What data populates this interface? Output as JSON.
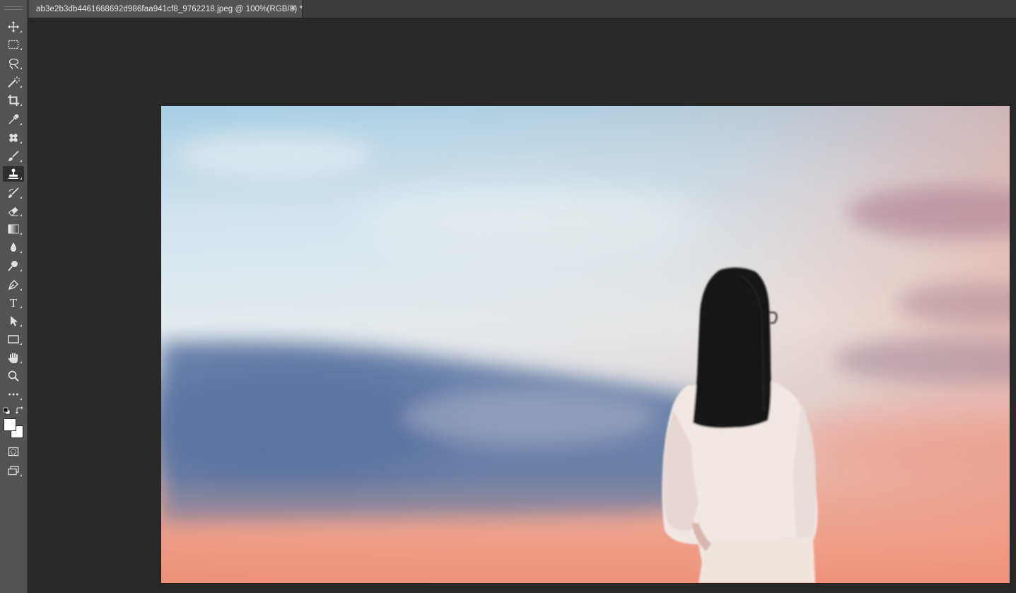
{
  "document_tab": {
    "title": "ab3e2b3db4461668692d986faa941cf8_9762218.jpeg @ 100%(RGB/8) *",
    "close_glyph": "×"
  },
  "toolbar": {
    "tools": [
      {
        "name": "move-tool",
        "icon": "move-icon"
      },
      {
        "name": "rectangular-marquee-tool",
        "icon": "marquee-icon"
      },
      {
        "name": "lasso-tool",
        "icon": "lasso-icon"
      },
      {
        "name": "magic-wand-tool",
        "icon": "magic-wand-icon"
      },
      {
        "name": "crop-tool",
        "icon": "crop-icon"
      },
      {
        "name": "eyedropper-tool",
        "icon": "eyedropper-icon"
      },
      {
        "name": "healing-brush-tool",
        "icon": "bandage-icon"
      },
      {
        "name": "brush-tool",
        "icon": "brush-icon"
      },
      {
        "name": "clone-stamp-tool",
        "icon": "stamp-icon",
        "active": true
      },
      {
        "name": "history-brush-tool",
        "icon": "history-brush-icon"
      },
      {
        "name": "eraser-tool",
        "icon": "eraser-icon"
      },
      {
        "name": "gradient-tool",
        "icon": "gradient-icon"
      },
      {
        "name": "blur-tool",
        "icon": "drop-icon"
      },
      {
        "name": "dodge-tool",
        "icon": "dodge-icon"
      },
      {
        "name": "pen-tool",
        "icon": "pen-icon"
      },
      {
        "name": "type-tool",
        "icon": "type-icon",
        "label": "T"
      },
      {
        "name": "path-selection-tool",
        "icon": "arrow-icon"
      },
      {
        "name": "rectangle-tool",
        "icon": "rectangle-icon"
      },
      {
        "name": "hand-tool",
        "icon": "hand-icon"
      },
      {
        "name": "zoom-tool",
        "icon": "zoom-icon"
      },
      {
        "name": "edit-toolbar",
        "icon": "more-icon"
      }
    ],
    "foreground_color": "#ffffff",
    "background_color": "#ffffff"
  },
  "colors": {
    "toolbar_bg": "#535353",
    "workspace_bg": "#282828",
    "tab_active_bg": "#535353",
    "tabbar_bg": "#3c3c3c"
  }
}
